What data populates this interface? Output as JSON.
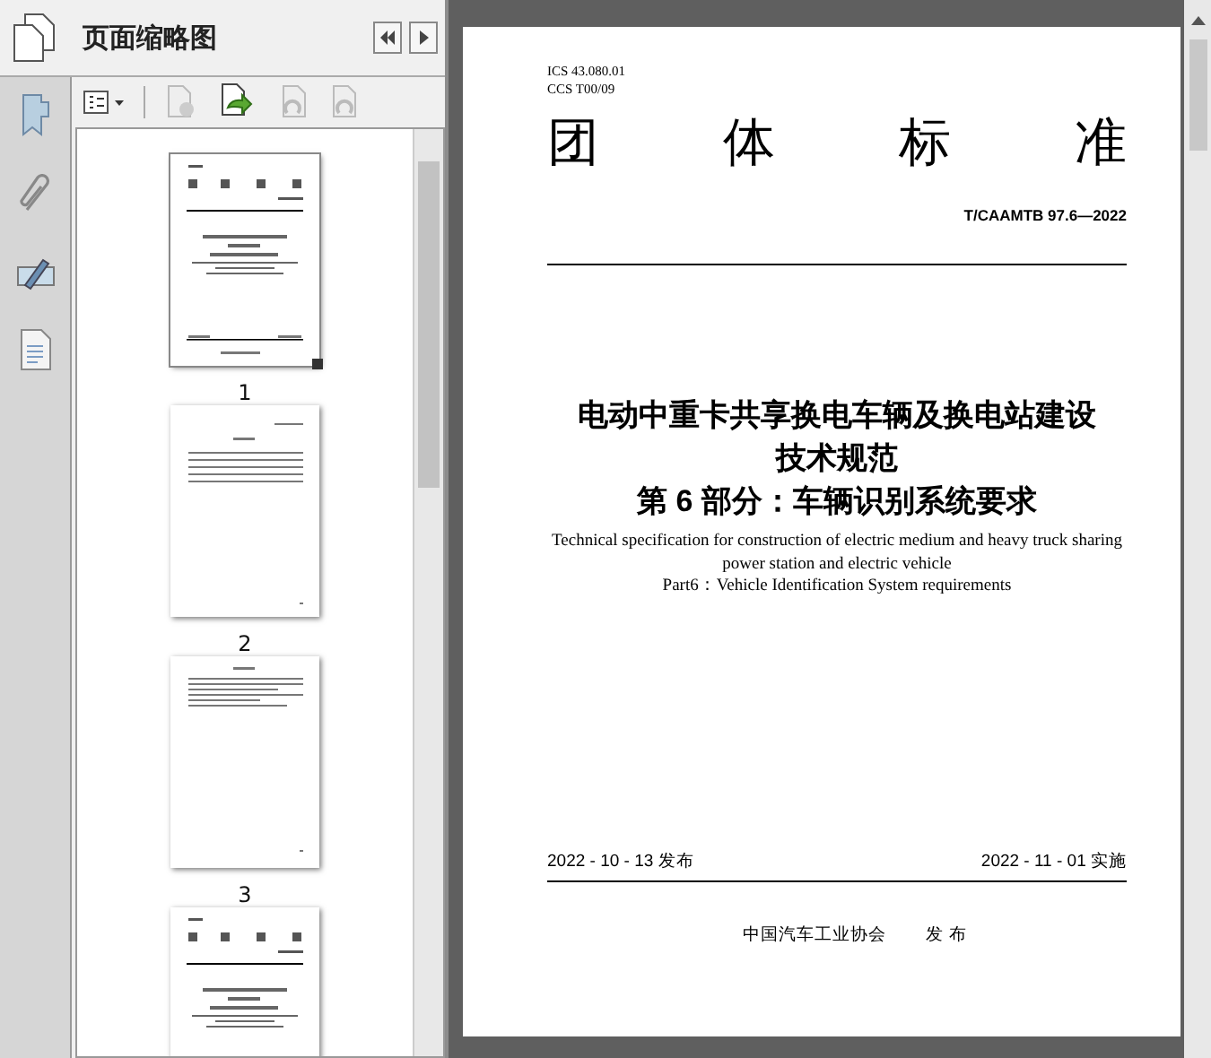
{
  "panel": {
    "title": "页面缩略图"
  },
  "thumbnails": [
    {
      "label": "1",
      "selected": true,
      "kind": "cover"
    },
    {
      "label": "2",
      "selected": false,
      "kind": "contents"
    },
    {
      "label": "3",
      "selected": false,
      "kind": "text"
    },
    {
      "selected": false,
      "kind": "cover"
    }
  ],
  "document": {
    "ics": "ICS  43.080.01",
    "ccs": "CCS T00/09",
    "heading_chars": [
      "团",
      "体",
      "标",
      "准"
    ],
    "standard_number": "T/CAAMTB 97.6—2022",
    "title_lines": [
      "电动中重卡共享换电车辆及换电站建设",
      "技术规范",
      "第 6 部分：车辆识别系统要求"
    ],
    "english_lines": [
      "Technical specification for construction of electric medium and heavy truck sharing",
      "power station and electric vehicle",
      "Part6：Vehicle Identification System requirements"
    ],
    "issue_date": "2022 - 10 - 13 发布",
    "implement_date": "2022 - 11 - 01 实施",
    "publisher": "中国汽车工业协会",
    "publish_word": "发 布"
  }
}
